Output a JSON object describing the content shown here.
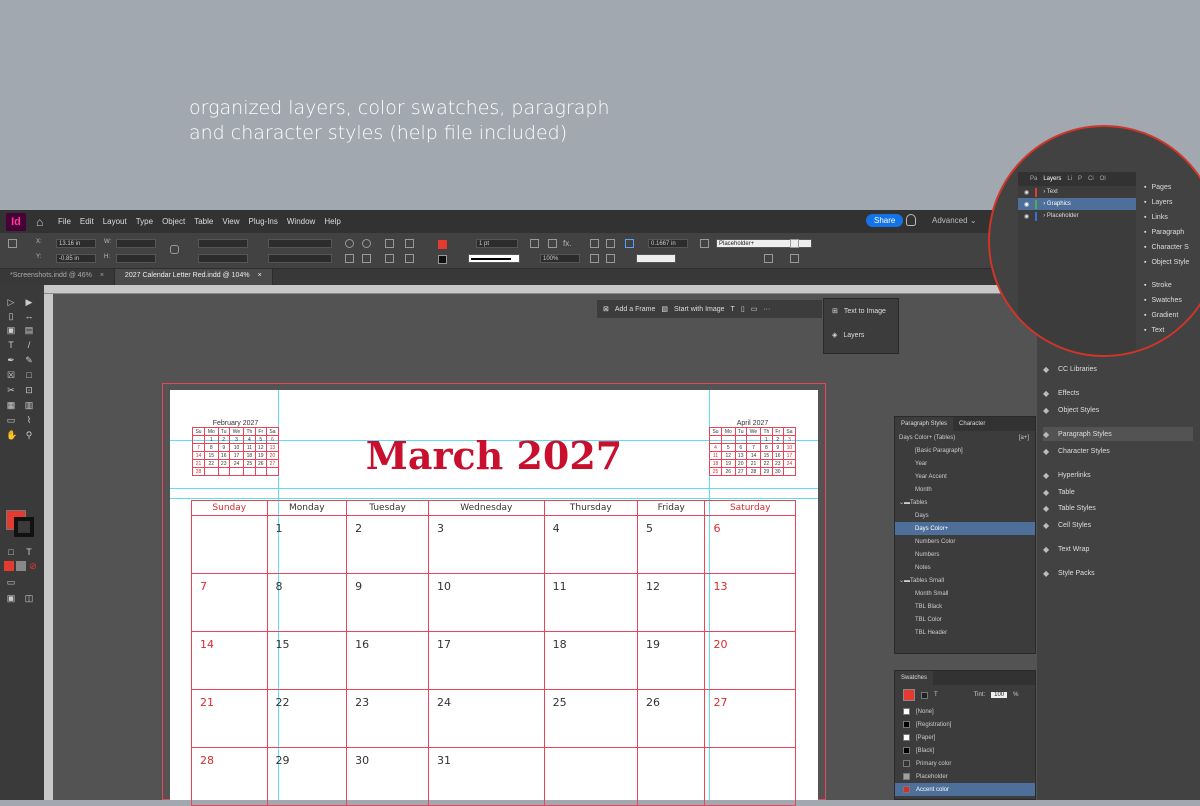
{
  "caption": {
    "line1": "organized layers, color swatches, paragraph",
    "line2": "and character styles (help file included)"
  },
  "app": {
    "logo": "Id",
    "menu": [
      "File",
      "Edit",
      "Layout",
      "Type",
      "Object",
      "Table",
      "View",
      "Plug-Ins",
      "Window",
      "Help"
    ],
    "share": "Share",
    "workspace": "Advanced"
  },
  "controls": {
    "x_label": "X:",
    "x_value": "13.16 in",
    "y_label": "Y:",
    "y_value": "-0.85 in",
    "w_label": "W:",
    "h_label": "H:",
    "stroke_weight": "1 pt",
    "opacity": "100%",
    "inset": "0.1667 in",
    "object_style": "Placeholder+"
  },
  "tabs": [
    {
      "label": "*Screenshots.indd @ 46%",
      "close": "×"
    },
    {
      "label": "2027 Calendar Letter Red.indd @ 104%",
      "close": "×"
    }
  ],
  "contextbar": {
    "add_frame": "Add a Frame",
    "start_image": "Start with Image",
    "text_to_image": "Text to Image",
    "layers": "Layers"
  },
  "calendar": {
    "title": "March 2027",
    "days": [
      "Sunday",
      "Monday",
      "Tuesday",
      "Wednesday",
      "Thursday",
      "Friday",
      "Saturday"
    ],
    "weeks": [
      [
        "",
        "1",
        "2",
        "3",
        "4",
        "5",
        "6"
      ],
      [
        "7",
        "8",
        "9",
        "10",
        "11",
        "12",
        "13"
      ],
      [
        "14",
        "15",
        "16",
        "17",
        "18",
        "19",
        "20"
      ],
      [
        "21",
        "22",
        "23",
        "24",
        "25",
        "26",
        "27"
      ],
      [
        "28",
        "29",
        "30",
        "31",
        "",
        "",
        ""
      ]
    ],
    "mini_left": {
      "title": "February 2027",
      "days": [
        "Su",
        "Mo",
        "Tu",
        "We",
        "Th",
        "Fr",
        "Sa"
      ],
      "weeks": [
        [
          "",
          "1",
          "2",
          "3",
          "4",
          "5",
          "6"
        ],
        [
          "7",
          "8",
          "9",
          "10",
          "11",
          "12",
          "13"
        ],
        [
          "14",
          "15",
          "16",
          "17",
          "18",
          "19",
          "20"
        ],
        [
          "21",
          "22",
          "23",
          "24",
          "25",
          "26",
          "27"
        ],
        [
          "28",
          "",
          "",
          "",
          "",
          "",
          ""
        ]
      ]
    },
    "mini_right": {
      "title": "April 2027",
      "days": [
        "Su",
        "Mo",
        "Tu",
        "We",
        "Th",
        "Fr",
        "Sa"
      ],
      "weeks": [
        [
          "",
          "",
          "",
          "",
          "1",
          "2",
          "3"
        ],
        [
          "4",
          "5",
          "6",
          "7",
          "8",
          "9",
          "10"
        ],
        [
          "11",
          "12",
          "13",
          "14",
          "15",
          "16",
          "17"
        ],
        [
          "18",
          "19",
          "20",
          "21",
          "22",
          "23",
          "24"
        ],
        [
          "25",
          "26",
          "27",
          "28",
          "29",
          "30",
          ""
        ]
      ]
    }
  },
  "paragraph_styles": {
    "tab1": "Paragraph Styles",
    "tab2": "Character",
    "current": "Days Color+ (Tables)",
    "items": [
      {
        "label": "[Basic Paragraph]",
        "type": "item"
      },
      {
        "label": "Year",
        "type": "item"
      },
      {
        "label": "Year Accent",
        "type": "item"
      },
      {
        "label": "Month",
        "type": "item"
      },
      {
        "label": "Tables",
        "type": "group"
      },
      {
        "label": "Days",
        "type": "sub"
      },
      {
        "label": "Days Color+",
        "type": "sub",
        "selected": true
      },
      {
        "label": "Numbers Color",
        "type": "sub"
      },
      {
        "label": "Numbers",
        "type": "sub"
      },
      {
        "label": "Notes",
        "type": "sub"
      },
      {
        "label": "Tables Small",
        "type": "group"
      },
      {
        "label": "Month Small",
        "type": "sub"
      },
      {
        "label": "TBL Black",
        "type": "sub"
      },
      {
        "label": "TBL Color",
        "type": "sub"
      },
      {
        "label": "TBL Header",
        "type": "sub"
      }
    ]
  },
  "swatches": {
    "title": "Swatches",
    "tint_label": "Tint:",
    "tint_value": "100",
    "percent": "%",
    "items": [
      {
        "label": "[None]",
        "color": "#ffffff"
      },
      {
        "label": "[Registration]",
        "color": "#000000"
      },
      {
        "label": "[Paper]",
        "color": "#ffffff"
      },
      {
        "label": "[Black]",
        "color": "#000000"
      },
      {
        "label": "Primary color",
        "color": "#333333"
      },
      {
        "label": "Placeholder",
        "color": "#9aa3a3"
      },
      {
        "label": "Accent color",
        "color": "#d92b30",
        "selected": true
      }
    ]
  },
  "right_panels": [
    {
      "label": "CC Libraries",
      "icon": "cc-libraries-icon"
    },
    {
      "label": "Effects",
      "icon": "effects-icon"
    },
    {
      "label": "Object Styles",
      "icon": "object-styles-icon"
    },
    {
      "label": "Paragraph Styles",
      "icon": "paragraph-styles-icon",
      "selected": true
    },
    {
      "label": "Character Styles",
      "icon": "character-styles-icon"
    },
    {
      "label": "Hyperlinks",
      "icon": "hyperlinks-icon"
    },
    {
      "label": "Table",
      "icon": "table-icon"
    },
    {
      "label": "Table Styles",
      "icon": "table-styles-icon"
    },
    {
      "label": "Cell Styles",
      "icon": "cell-styles-icon"
    },
    {
      "label": "Text Wrap",
      "icon": "text-wrap-icon"
    },
    {
      "label": "Style Packs",
      "icon": "style-packs-icon"
    }
  ],
  "magnifier": {
    "tabs": [
      "Pa",
      "Layers",
      "Li",
      "P",
      "Ci",
      "Ol"
    ],
    "layers": [
      {
        "label": "Text",
        "color": "#e43a30"
      },
      {
        "label": "Graphics",
        "color": "#4caf50",
        "selected": true
      },
      {
        "label": "Placeholder",
        "color": "#3a6fd8"
      }
    ],
    "panels": [
      "Pages",
      "Layers",
      "Links",
      "Paragraph",
      "Character S",
      "Object Style",
      "Stroke",
      "Swatches",
      "Gradient",
      "Text"
    ]
  }
}
